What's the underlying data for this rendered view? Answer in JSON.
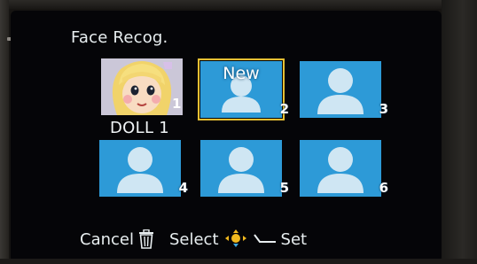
{
  "screen": {
    "title": "Face Recog."
  },
  "slots": [
    {
      "number": "1",
      "name": "DOLL 1",
      "state": "registered"
    },
    {
      "number": "2",
      "badge": "New",
      "state": "selected"
    },
    {
      "number": "3",
      "state": "empty"
    },
    {
      "number": "4",
      "state": "empty"
    },
    {
      "number": "5",
      "state": "empty"
    },
    {
      "number": "6",
      "state": "empty"
    }
  ],
  "footer": {
    "cancel_label": "Cancel",
    "cancel_icon": "trash-icon",
    "select_label": "Select",
    "select_icon": "dpad-icon",
    "set_label": "Set",
    "set_icon": "enter-icon"
  },
  "colors": {
    "slot_blue": "#2d9ad7",
    "silhouette": "#cfe6f3",
    "selection": "#e5bf33",
    "dpad": "#f0b81e"
  }
}
